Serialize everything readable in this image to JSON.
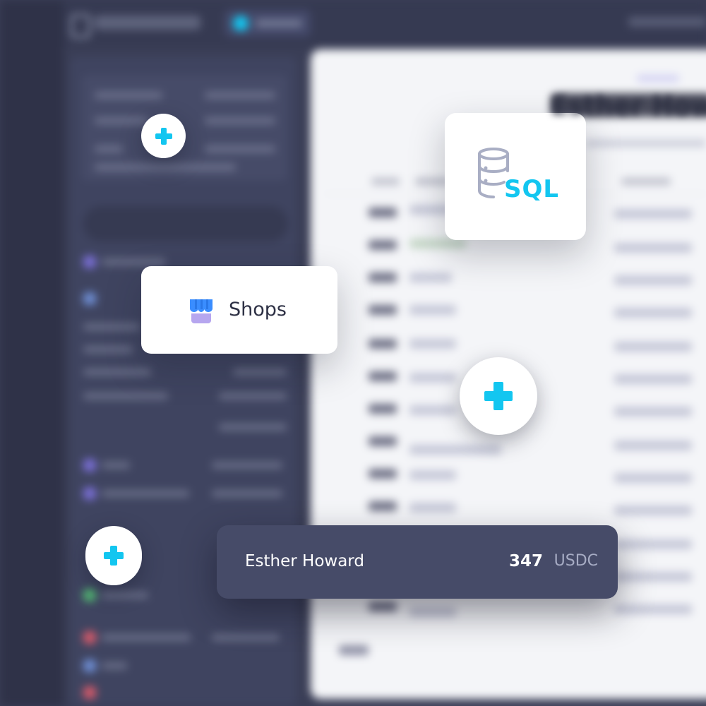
{
  "sql_card": {
    "label": "SQL",
    "icon": "database-icon"
  },
  "shops_card": {
    "label": "Shops",
    "icon": "shop-icon"
  },
  "payout_card": {
    "name": "Esther Howard",
    "amount": "347",
    "currency": "USDC"
  },
  "background_dashboard": {
    "profile_title": "Esther How"
  },
  "colors": {
    "accent": "#13c6f0",
    "card_dark": "#464b68",
    "background": "#3a3e56",
    "shop_blue": "#3a8dff",
    "shop_lavender": "#b6a6ef"
  }
}
